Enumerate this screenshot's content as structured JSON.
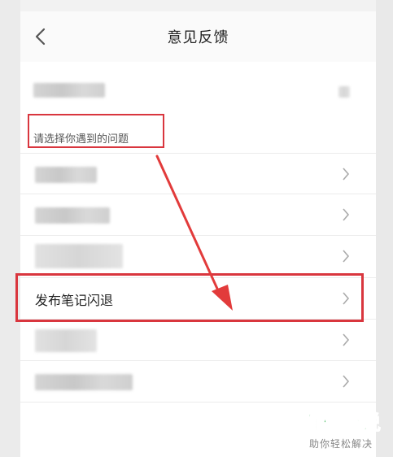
{
  "header": {
    "title": "意见反馈",
    "back_icon": "chevron-left-icon"
  },
  "section": {
    "label": "请选择你遇到的问题"
  },
  "rows": [
    {
      "label": ""
    },
    {
      "label": ""
    },
    {
      "label": ""
    },
    {
      "label": "发布笔记闪退"
    },
    {
      "label": ""
    },
    {
      "label": ""
    }
  ],
  "watermark": {
    "brand": "百科全说",
    "tagline": "助你轻松解决"
  },
  "colors": {
    "annotation": "#d9363e",
    "watermark_green": "#2fb24c",
    "text_primary": "#222222",
    "text_secondary": "#555555"
  }
}
